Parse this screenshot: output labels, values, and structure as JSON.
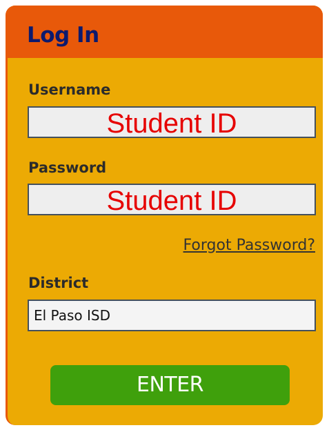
{
  "header": {
    "title": "Log In"
  },
  "username": {
    "label": "Username",
    "value": "Student ID"
  },
  "password": {
    "label": "Password",
    "value": "Student ID"
  },
  "forgot_password": {
    "label": "Forgot Password?"
  },
  "district": {
    "label": "District",
    "selected": "El Paso ISD"
  },
  "enter_button": {
    "label": "ENTER"
  },
  "colors": {
    "panel": "#ecaa04",
    "header": "#e8590a",
    "title_text": "#0c1a6e",
    "input_text": "#e60000",
    "button": "#3fa00c"
  }
}
